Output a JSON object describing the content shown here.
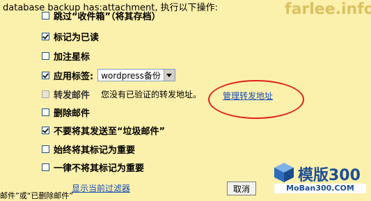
{
  "header": {
    "text": "database backup has:attachment, 执行以下操作:"
  },
  "watermark": "farlee.info",
  "actions": [
    {
      "label": "跳过“收件箱”（将其存档）",
      "checked": false
    },
    {
      "label": "标记为已读",
      "checked": true
    },
    {
      "label": "加注星标",
      "checked": false
    },
    {
      "label": "应用标签:",
      "checked": true
    },
    {
      "label": "转发邮件",
      "checked": false,
      "disabled": true
    },
    {
      "label": "删除邮件",
      "checked": false
    },
    {
      "label": "不要将其发送至“垃圾邮件”",
      "checked": true
    },
    {
      "label": "始终将其标记为重要",
      "checked": false
    },
    {
      "label": "一律不将其标记为重要",
      "checked": false
    }
  ],
  "label_select": {
    "value": "wordpress备份"
  },
  "forward": {
    "note": "您没有已验证的转发地址。",
    "manage_link": "管理转发地址"
  },
  "footer": {
    "truncated_text": "邮件”或“已删除邮件”",
    "show_filter_link": "显示当前过滤器",
    "cancel_button": "取消"
  },
  "logo": {
    "title": "模版300",
    "subtitle": "MoBan300.COM"
  },
  "colors": {
    "background": "#fcf0ad",
    "link": "#1a4fb5",
    "annotation_ellipse": "#e0201a"
  }
}
